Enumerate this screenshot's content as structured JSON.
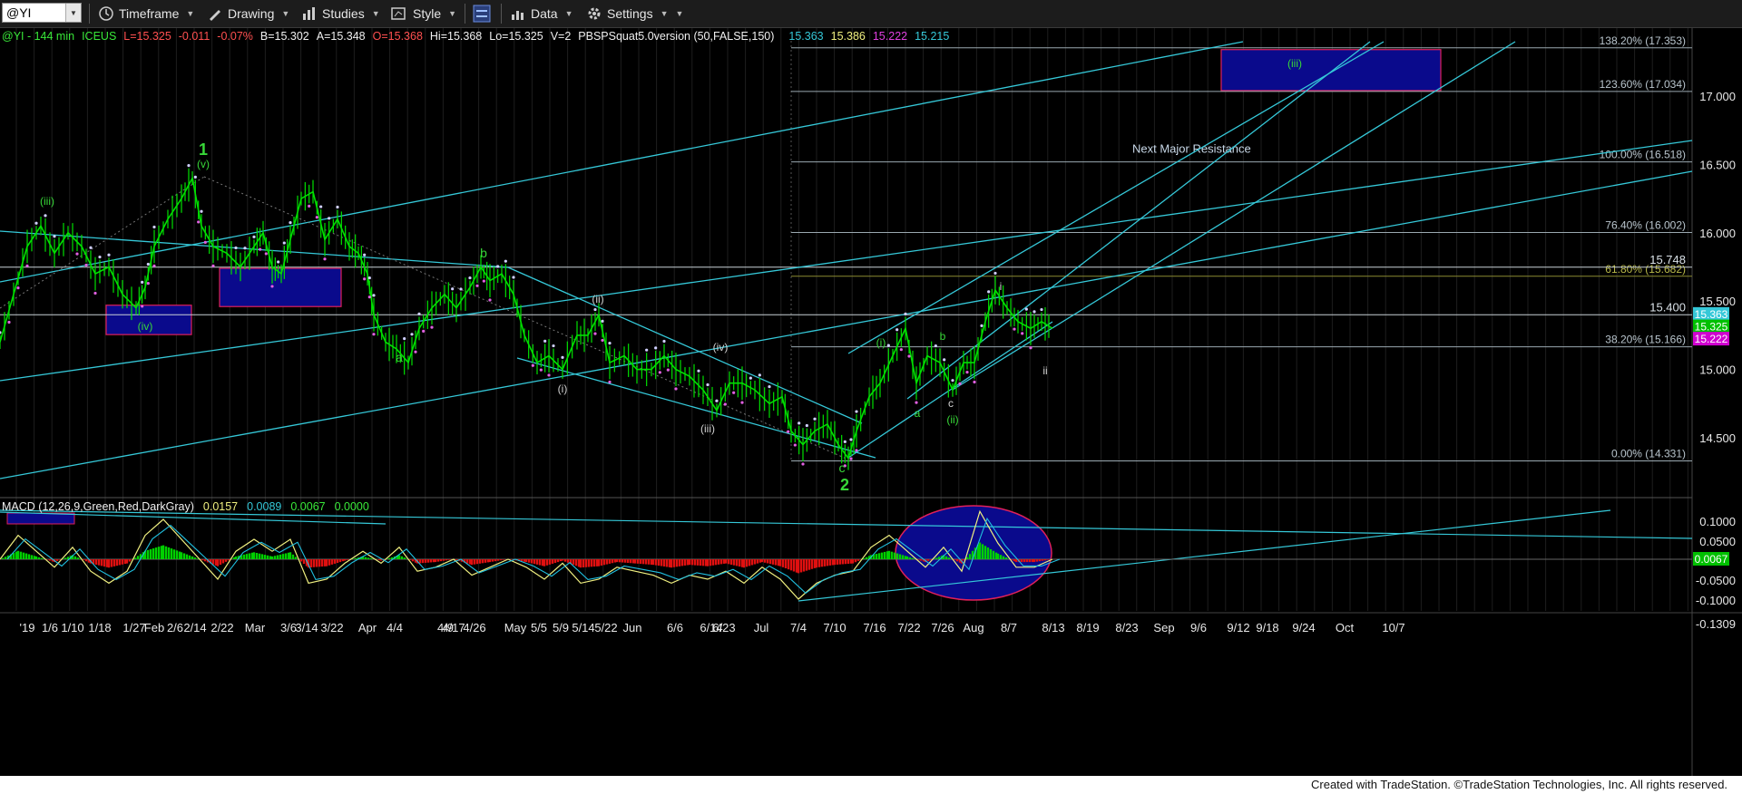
{
  "toolbar": {
    "symbol": "@YI",
    "timeframe": "Timeframe",
    "drawing": "Drawing",
    "studies": "Studies",
    "style": "Style",
    "data": "Data",
    "settings": "Settings"
  },
  "header": {
    "symbol": "@YI - 144 min",
    "exchange": "ICEUS",
    "last": "L=15.325",
    "change": "-0.011",
    "pct": "-0.07%",
    "bid": "B=15.302",
    "ask": "A=15.348",
    "open": "O=15.368",
    "high": "Hi=15.368",
    "low": "Lo=15.325",
    "vol": "V=2",
    "study": "PBSPSquat5.0version (50,FALSE,150)",
    "study_values": [
      "15.363",
      "15.386",
      "15.222",
      "15.215"
    ]
  },
  "macd_header": {
    "name": "MACD (12,26,9,Green,Red,DarkGray)",
    "values": [
      "0.0157",
      "0.0089",
      "0.0067",
      "0.0000"
    ]
  },
  "footer": "Created with TradeStation. ©TradeStation Technologies, Inc. All rights reserved.",
  "colors": {
    "bg": "#000000",
    "candle": "#00e000",
    "trend": "#35c8d8",
    "grid": "#1e1e1e",
    "box": "#0a0a8c"
  },
  "chart_data": {
    "type": "line",
    "price_axis": {
      "range": [
        14.1,
        17.55
      ],
      "ticks": [
        17.0,
        16.5,
        16.0,
        15.5,
        15.0,
        14.5
      ]
    },
    "macd_axis": {
      "range": [
        -0.14,
        0.13
      ],
      "ticks": [
        "0.1000",
        "0.0500",
        "-0.0500",
        "-0.1000",
        "-0.1309"
      ],
      "last": "0.0067"
    },
    "x_ticks": [
      "'19",
      "1/6",
      "1/10",
      "1/18",
      "1/27",
      "Feb",
      "2/6",
      "2/14",
      "2/22",
      "Mar",
      "3/6",
      "3/14",
      "3/22",
      "Apr",
      "4/4",
      "4/9",
      "4/17",
      "4/26",
      "May",
      "5/5",
      "5/9",
      "5/14",
      "5/22",
      "Jun",
      "6/6",
      "6/14",
      "6/23",
      "Jul",
      "7/4",
      "7/10",
      "7/16",
      "7/22",
      "7/26",
      "Aug",
      "8/7",
      "8/13",
      "8/19",
      "8/23",
      "Sep",
      "9/6",
      "9/12",
      "9/18",
      "9/24",
      "Oct",
      "10/7"
    ],
    "price_path": [
      [
        0,
        15.2
      ],
      [
        15,
        15.55
      ],
      [
        30,
        15.9
      ],
      [
        45,
        16.05
      ],
      [
        60,
        15.85
      ],
      [
        75,
        16.0
      ],
      [
        90,
        15.9
      ],
      [
        105,
        15.7
      ],
      [
        120,
        15.75
      ],
      [
        135,
        15.55
      ],
      [
        150,
        15.45
      ],
      [
        160,
        15.6
      ],
      [
        170,
        15.9
      ],
      [
        185,
        16.1
      ],
      [
        200,
        16.25
      ],
      [
        212,
        16.4
      ],
      [
        222,
        16.05
      ],
      [
        235,
        15.9
      ],
      [
        250,
        15.85
      ],
      [
        265,
        15.75
      ],
      [
        280,
        15.9
      ],
      [
        290,
        16.0
      ],
      [
        300,
        15.75
      ],
      [
        310,
        15.7
      ],
      [
        320,
        15.95
      ],
      [
        332,
        16.25
      ],
      [
        345,
        16.3
      ],
      [
        358,
        15.95
      ],
      [
        372,
        16.1
      ],
      [
        385,
        15.9
      ],
      [
        395,
        15.85
      ],
      [
        405,
        15.7
      ],
      [
        412,
        15.4
      ],
      [
        425,
        15.2
      ],
      [
        437,
        15.15
      ],
      [
        450,
        15.05
      ],
      [
        462,
        15.3
      ],
      [
        476,
        15.45
      ],
      [
        490,
        15.55
      ],
      [
        503,
        15.45
      ],
      [
        518,
        15.6
      ],
      [
        530,
        15.75
      ],
      [
        540,
        15.65
      ],
      [
        553,
        15.7
      ],
      [
        566,
        15.55
      ],
      [
        578,
        15.25
      ],
      [
        592,
        15.05
      ],
      [
        605,
        15.1
      ],
      [
        620,
        15.0
      ],
      [
        636,
        15.25
      ],
      [
        648,
        15.25
      ],
      [
        660,
        15.4
      ],
      [
        672,
        15.05
      ],
      [
        688,
        15.1
      ],
      [
        702,
        15.0
      ],
      [
        718,
        15.0
      ],
      [
        732,
        15.1
      ],
      [
        745,
        15.0
      ],
      [
        760,
        14.95
      ],
      [
        775,
        14.85
      ],
      [
        790,
        14.7
      ],
      [
        804,
        14.9
      ],
      [
        818,
        14.9
      ],
      [
        832,
        14.85
      ],
      [
        848,
        14.75
      ],
      [
        862,
        14.8
      ],
      [
        872,
        14.55
      ],
      [
        885,
        14.45
      ],
      [
        898,
        14.55
      ],
      [
        912,
        14.6
      ],
      [
        924,
        14.45
      ],
      [
        935,
        14.35
      ],
      [
        944,
        14.55
      ],
      [
        958,
        14.8
      ],
      [
        970,
        14.9
      ],
      [
        984,
        15.1
      ],
      [
        998,
        15.3
      ],
      [
        1010,
        14.9
      ],
      [
        1022,
        15.1
      ],
      [
        1036,
        15.05
      ],
      [
        1050,
        14.85
      ],
      [
        1062,
        15.05
      ],
      [
        1074,
        15.05
      ],
      [
        1086,
        15.35
      ],
      [
        1097,
        15.58
      ],
      [
        1110,
        15.45
      ],
      [
        1122,
        15.35
      ],
      [
        1136,
        15.3
      ],
      [
        1148,
        15.35
      ],
      [
        1160,
        15.3
      ]
    ],
    "macd_path": [
      [
        0,
        0.0
      ],
      [
        20,
        0.06
      ],
      [
        40,
        0.02
      ],
      [
        60,
        -0.02
      ],
      [
        80,
        0.03
      ],
      [
        100,
        -0.03
      ],
      [
        120,
        -0.06
      ],
      [
        140,
        -0.03
      ],
      [
        160,
        0.06
      ],
      [
        180,
        0.1
      ],
      [
        200,
        0.05
      ],
      [
        220,
        0.0
      ],
      [
        240,
        -0.05
      ],
      [
        260,
        0.02
      ],
      [
        280,
        0.05
      ],
      [
        300,
        0.02
      ],
      [
        320,
        0.05
      ],
      [
        340,
        -0.06
      ],
      [
        360,
        -0.05
      ],
      [
        380,
        -0.01
      ],
      [
        400,
        0.02
      ],
      [
        420,
        -0.01
      ],
      [
        440,
        0.03
      ],
      [
        460,
        -0.03
      ],
      [
        480,
        -0.02
      ],
      [
        500,
        0.0
      ],
      [
        520,
        -0.04
      ],
      [
        540,
        -0.02
      ],
      [
        560,
        0.0
      ],
      [
        580,
        -0.02
      ],
      [
        600,
        -0.05
      ],
      [
        620,
        -0.01
      ],
      [
        640,
        -0.06
      ],
      [
        660,
        -0.05
      ],
      [
        680,
        -0.02
      ],
      [
        700,
        -0.03
      ],
      [
        720,
        -0.04
      ],
      [
        740,
        -0.06
      ],
      [
        760,
        -0.04
      ],
      [
        780,
        -0.05
      ],
      [
        800,
        -0.03
      ],
      [
        820,
        -0.06
      ],
      [
        840,
        -0.02
      ],
      [
        860,
        -0.05
      ],
      [
        880,
        -0.1
      ],
      [
        900,
        -0.06
      ],
      [
        920,
        -0.04
      ],
      [
        940,
        -0.03
      ],
      [
        960,
        0.03
      ],
      [
        980,
        0.06
      ],
      [
        1000,
        0.02
      ],
      [
        1020,
        -0.02
      ],
      [
        1040,
        0.03
      ],
      [
        1060,
        -0.03
      ],
      [
        1080,
        0.12
      ],
      [
        1100,
        0.04
      ],
      [
        1120,
        -0.02
      ],
      [
        1140,
        -0.02
      ],
      [
        1160,
        0.0
      ]
    ],
    "fib_levels": [
      {
        "label": "138.20% (17.353)",
        "value": 17.353
      },
      {
        "label": "123.60% (17.034)",
        "value": 17.034
      },
      {
        "label": "100.00% (16.518)",
        "value": 16.518
      },
      {
        "label": "76.40% (16.002)",
        "value": 16.002
      },
      {
        "label": "61.80% (15.682)",
        "value": 15.682
      },
      {
        "label": "38.20% (15.166)",
        "value": 15.166
      },
      {
        "label": "0.00% (14.331)",
        "value": 14.331
      }
    ],
    "horizontal_lines": [
      {
        "label": "15.748",
        "value": 15.748
      },
      {
        "label": "15.400",
        "value": 15.4
      }
    ],
    "price_tags": [
      {
        "label": "15.363",
        "value": 15.363,
        "color": "#35c8d8"
      },
      {
        "label": "15.325",
        "value": 15.325,
        "color": "#00c000"
      },
      {
        "label": "15.222",
        "value": 15.222,
        "color": "#d000d0"
      }
    ],
    "annotations": [
      {
        "text": "Next Major Resistance"
      },
      {
        "text": "1"
      },
      {
        "text": "2"
      },
      {
        "text": "(iii)"
      },
      {
        "text": "(v)"
      },
      {
        "text": "(iv)"
      },
      {
        "text": "b"
      },
      {
        "text": "a"
      },
      {
        "text": "(ii)"
      },
      {
        "text": "(i)"
      },
      {
        "text": "(iii)"
      },
      {
        "text": "(iv)"
      },
      {
        "text": "c"
      },
      {
        "text": "(i)"
      },
      {
        "text": "b"
      },
      {
        "text": "a"
      },
      {
        "text": "c"
      },
      {
        "text": "(ii)"
      },
      {
        "text": "i"
      },
      {
        "text": "ii"
      },
      {
        "text": "(iii)"
      }
    ]
  }
}
